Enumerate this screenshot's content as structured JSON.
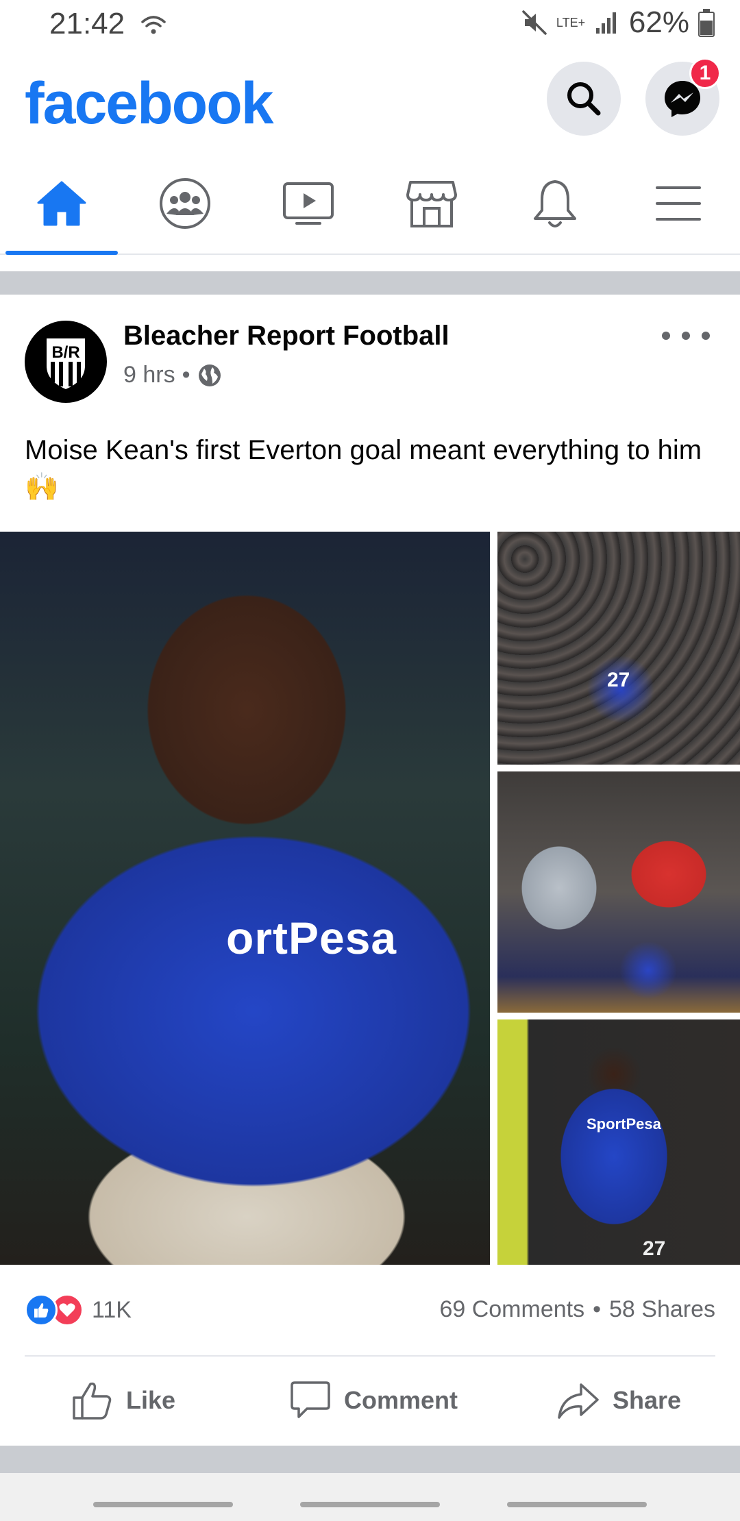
{
  "status_bar": {
    "time": "21:42",
    "network": "LTE+",
    "battery": "62%"
  },
  "app": {
    "logo": "facebook",
    "messenger_badge": "1",
    "icons": {
      "search": "search-icon",
      "messenger": "messenger-icon"
    }
  },
  "tabs": [
    {
      "name": "home",
      "icon": "home-icon",
      "active": true
    },
    {
      "name": "groups",
      "icon": "groups-icon",
      "active": false
    },
    {
      "name": "watch",
      "icon": "video-icon",
      "active": false
    },
    {
      "name": "marketplace",
      "icon": "marketplace-icon",
      "active": false
    },
    {
      "name": "notifications",
      "icon": "bell-icon",
      "active": false
    },
    {
      "name": "menu",
      "icon": "hamburger-icon",
      "active": false
    }
  ],
  "post": {
    "author": "Bleacher Report Football",
    "avatar_text": "B/R",
    "time": "9 hrs",
    "separator": "•",
    "text": "Moise Kean's first Everton goal meant everything to him",
    "emoji": "🙌",
    "photo_texts": {
      "main_sponsor": "ortPesa",
      "side3_sponsor": "SportPesa",
      "side1_number": "27",
      "side3_number": "27"
    },
    "reactions_count": "11K",
    "comments": "69 Comments",
    "shares": "58 Shares",
    "stats_separator": "•"
  },
  "actions": {
    "like": "Like",
    "comment": "Comment",
    "share": "Share"
  },
  "colors": {
    "brand": "#1877f2",
    "badge": "#f02849",
    "love": "#f33e58",
    "muted": "#65676b"
  }
}
